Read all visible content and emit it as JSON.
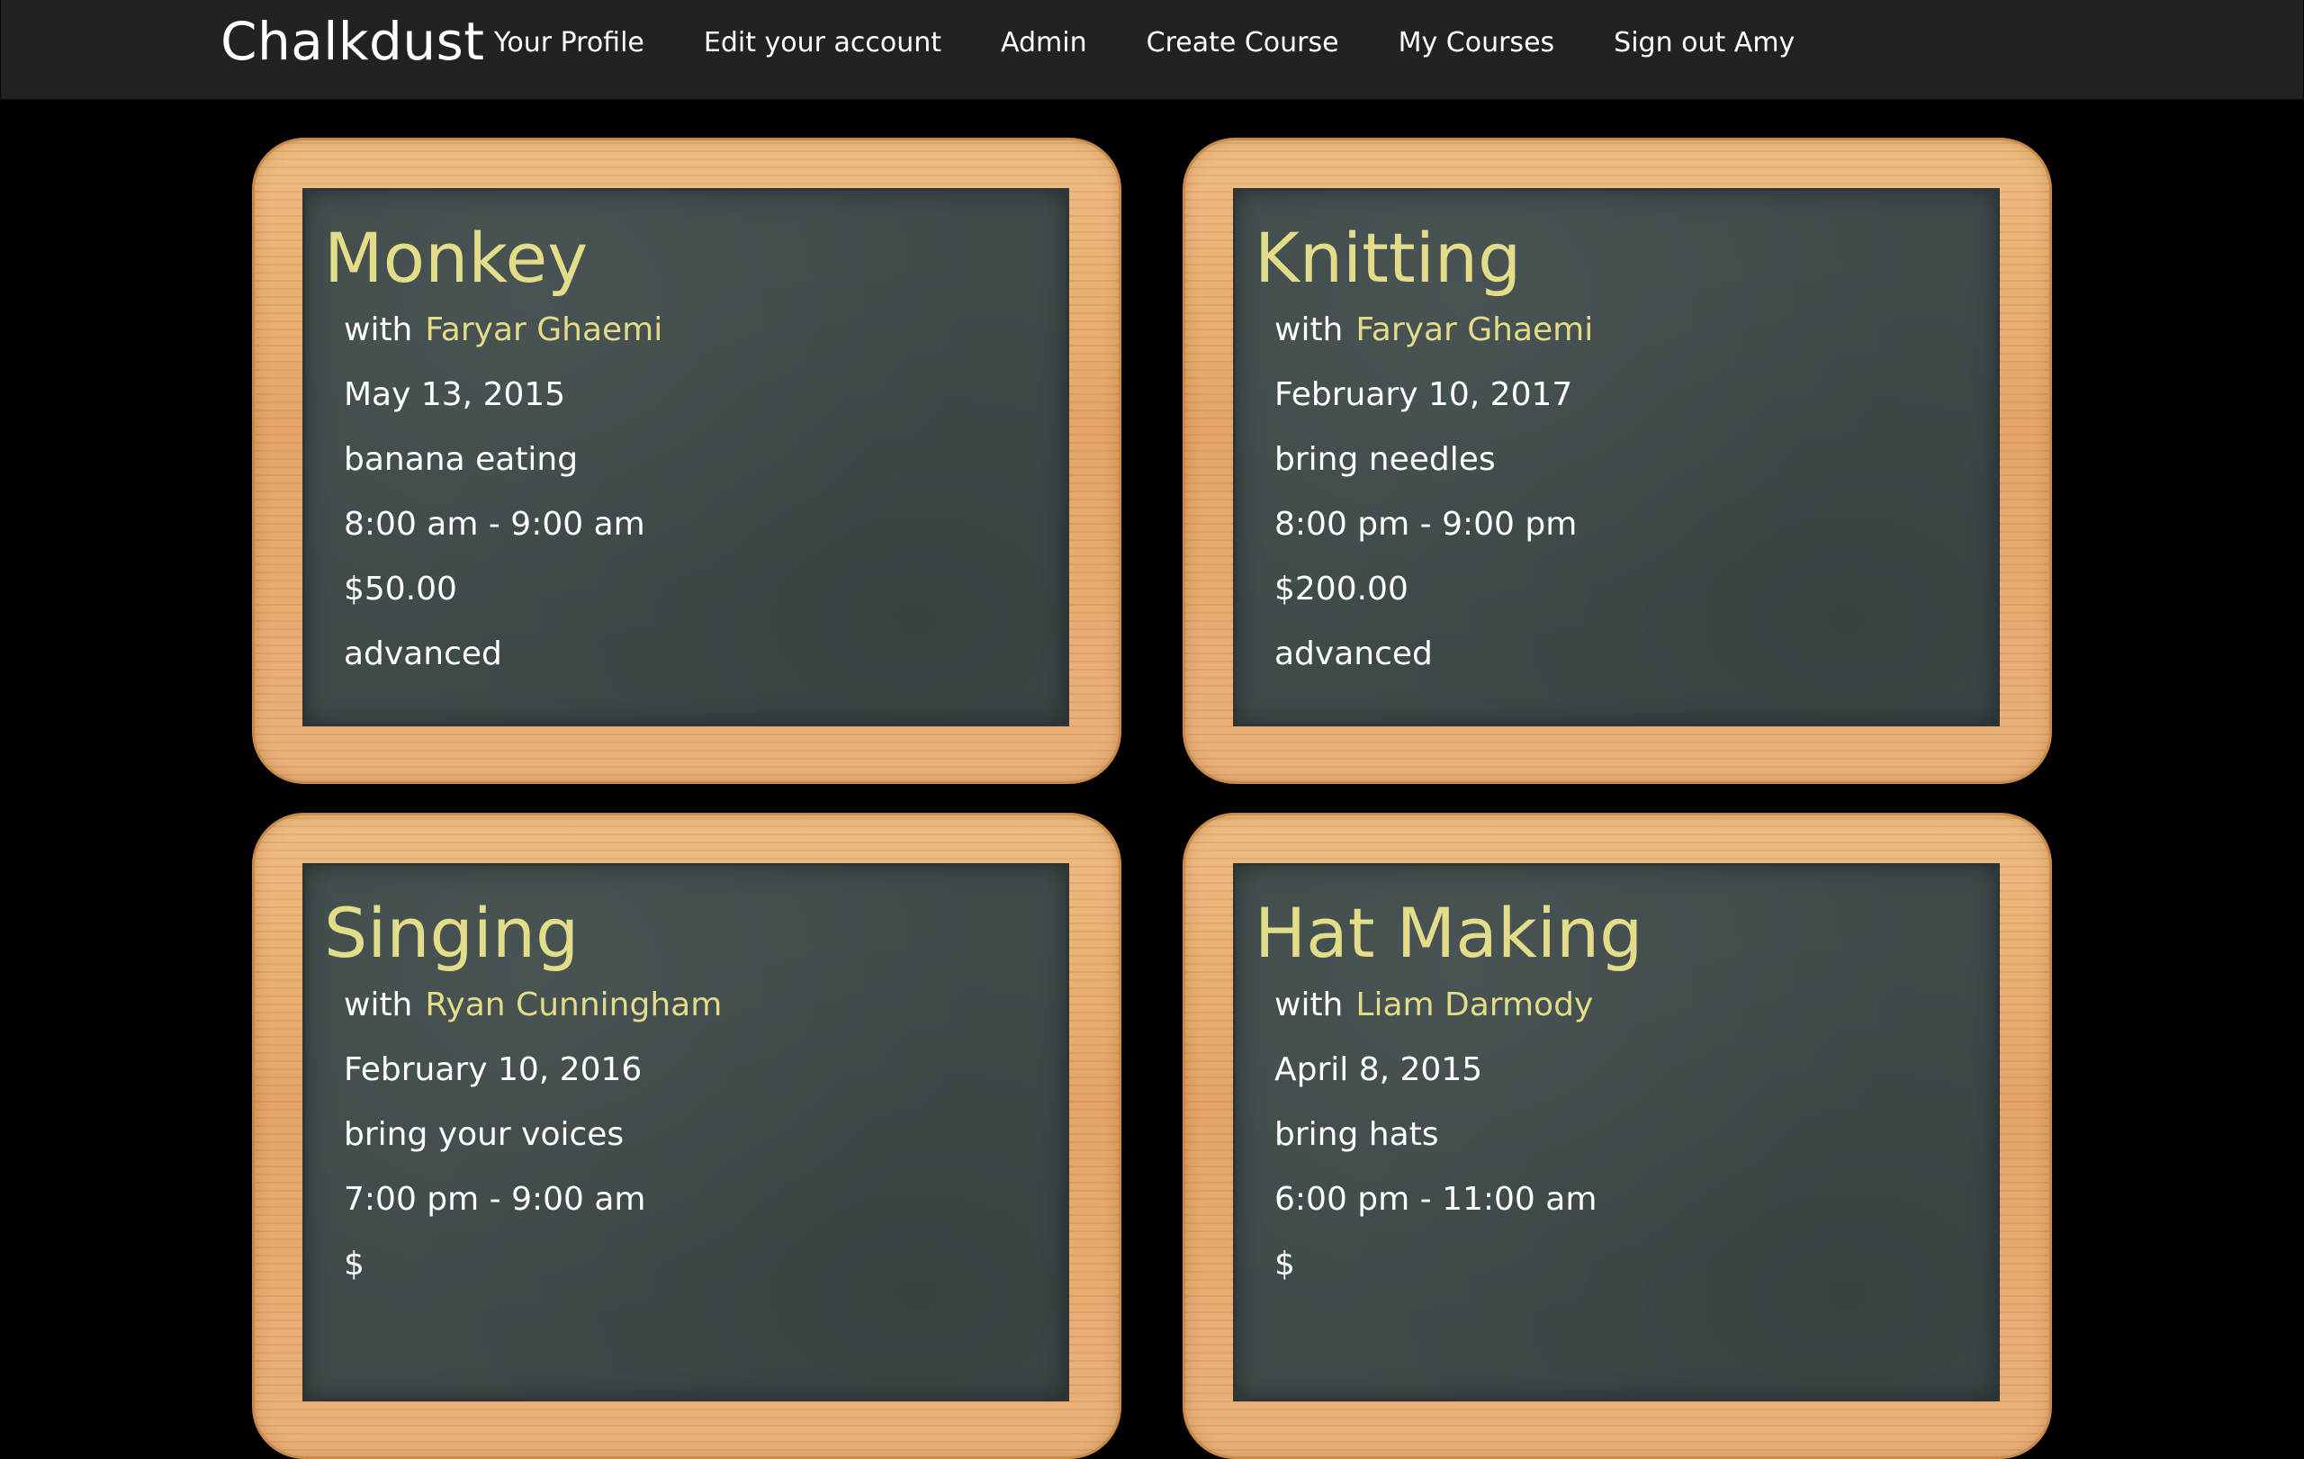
{
  "nav": {
    "brand": "Chalkdust",
    "links": [
      {
        "label": "Your Profile"
      },
      {
        "label": "Edit your account"
      },
      {
        "label": "Admin"
      },
      {
        "label": "Create Course"
      },
      {
        "label": "My Courses"
      },
      {
        "label": "Sign out Amy"
      }
    ]
  },
  "courses": [
    {
      "title": "Monkey",
      "with_label": "with",
      "instructor": "Faryar Ghaemi",
      "date": "May 13, 2015",
      "description": "banana eating",
      "time": "8:00 am - 9:00 am",
      "price": "$50.00",
      "level": "advanced"
    },
    {
      "title": "Knitting",
      "with_label": "with",
      "instructor": "Faryar Ghaemi",
      "date": "February 10, 2017",
      "description": "bring needles",
      "time": "8:00 pm - 9:00 pm",
      "price": "$200.00",
      "level": "advanced"
    },
    {
      "title": "Singing",
      "with_label": "with",
      "instructor": "Ryan Cunningham",
      "date": "February 10, 2016",
      "description": "bring your voices",
      "time": "7:00 pm - 9:00 am",
      "price": "$",
      "level": ""
    },
    {
      "title": "Hat Making",
      "with_label": "with",
      "instructor": "Liam Darmody",
      "date": "April 8, 2015",
      "description": "bring hats",
      "time": "6:00 pm - 11:00 am",
      "price": "$",
      "level": ""
    }
  ]
}
